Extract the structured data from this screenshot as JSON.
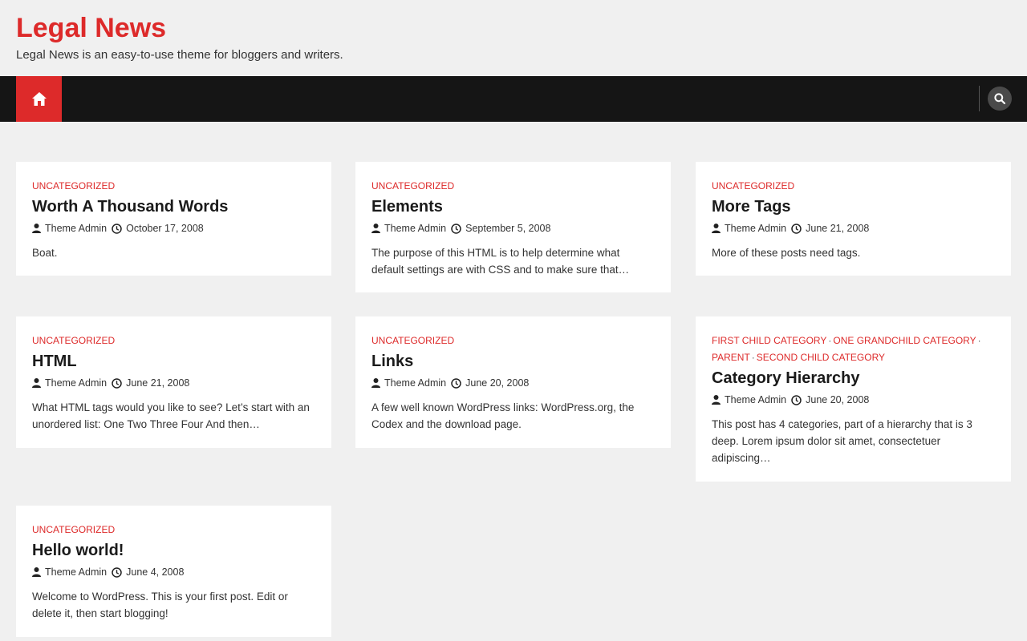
{
  "site": {
    "title": "Legal News",
    "description": "Legal News is an easy-to-use theme for bloggers and writers."
  },
  "colors": {
    "accent": "#dd2a2a",
    "nav_bg": "#151515",
    "page_bg": "#f0f0f0"
  },
  "nav": {
    "home_icon": "home-icon",
    "search_icon": "search-icon"
  },
  "posts": [
    {
      "categories": [
        "Uncategorized"
      ],
      "title": "Worth A Thousand Words",
      "author": "Theme Admin",
      "date": "October 17, 2008",
      "excerpt": "Boat."
    },
    {
      "categories": [
        "Uncategorized"
      ],
      "title": "Elements",
      "author": "Theme Admin",
      "date": "September 5, 2008",
      "excerpt": "The purpose of this HTML is to help determine what default settings are with CSS and to make sure that…"
    },
    {
      "categories": [
        "Uncategorized"
      ],
      "title": "More Tags",
      "author": "Theme Admin",
      "date": "June 21, 2008",
      "excerpt": "More of these posts need tags."
    },
    {
      "categories": [
        "Uncategorized"
      ],
      "title": "HTML",
      "author": "Theme Admin",
      "date": "June 21, 2008",
      "excerpt": "What HTML tags would you like to see? Let’s start with an unordered list: One Two Three Four And then…"
    },
    {
      "categories": [
        "Uncategorized"
      ],
      "title": "Links",
      "author": "Theme Admin",
      "date": "June 20, 2008",
      "excerpt": "A few well known WordPress links: WordPress.org, the Codex and the download page."
    },
    {
      "categories": [
        "First Child Category",
        "One Grandchild Category",
        "Parent",
        "Second Child Category"
      ],
      "title": "Category Hierarchy",
      "author": "Theme Admin",
      "date": "June 20, 2008",
      "excerpt": "This post has 4 categories, part of a hierarchy that is 3 deep. Lorem ipsum dolor sit amet, consectetuer adipiscing…"
    },
    {
      "categories": [
        "Uncategorized"
      ],
      "title": "Hello world!",
      "author": "Theme Admin",
      "date": "June 4, 2008",
      "excerpt": "Welcome to WordPress. This is your first post. Edit or delete it, then start blogging!"
    }
  ]
}
